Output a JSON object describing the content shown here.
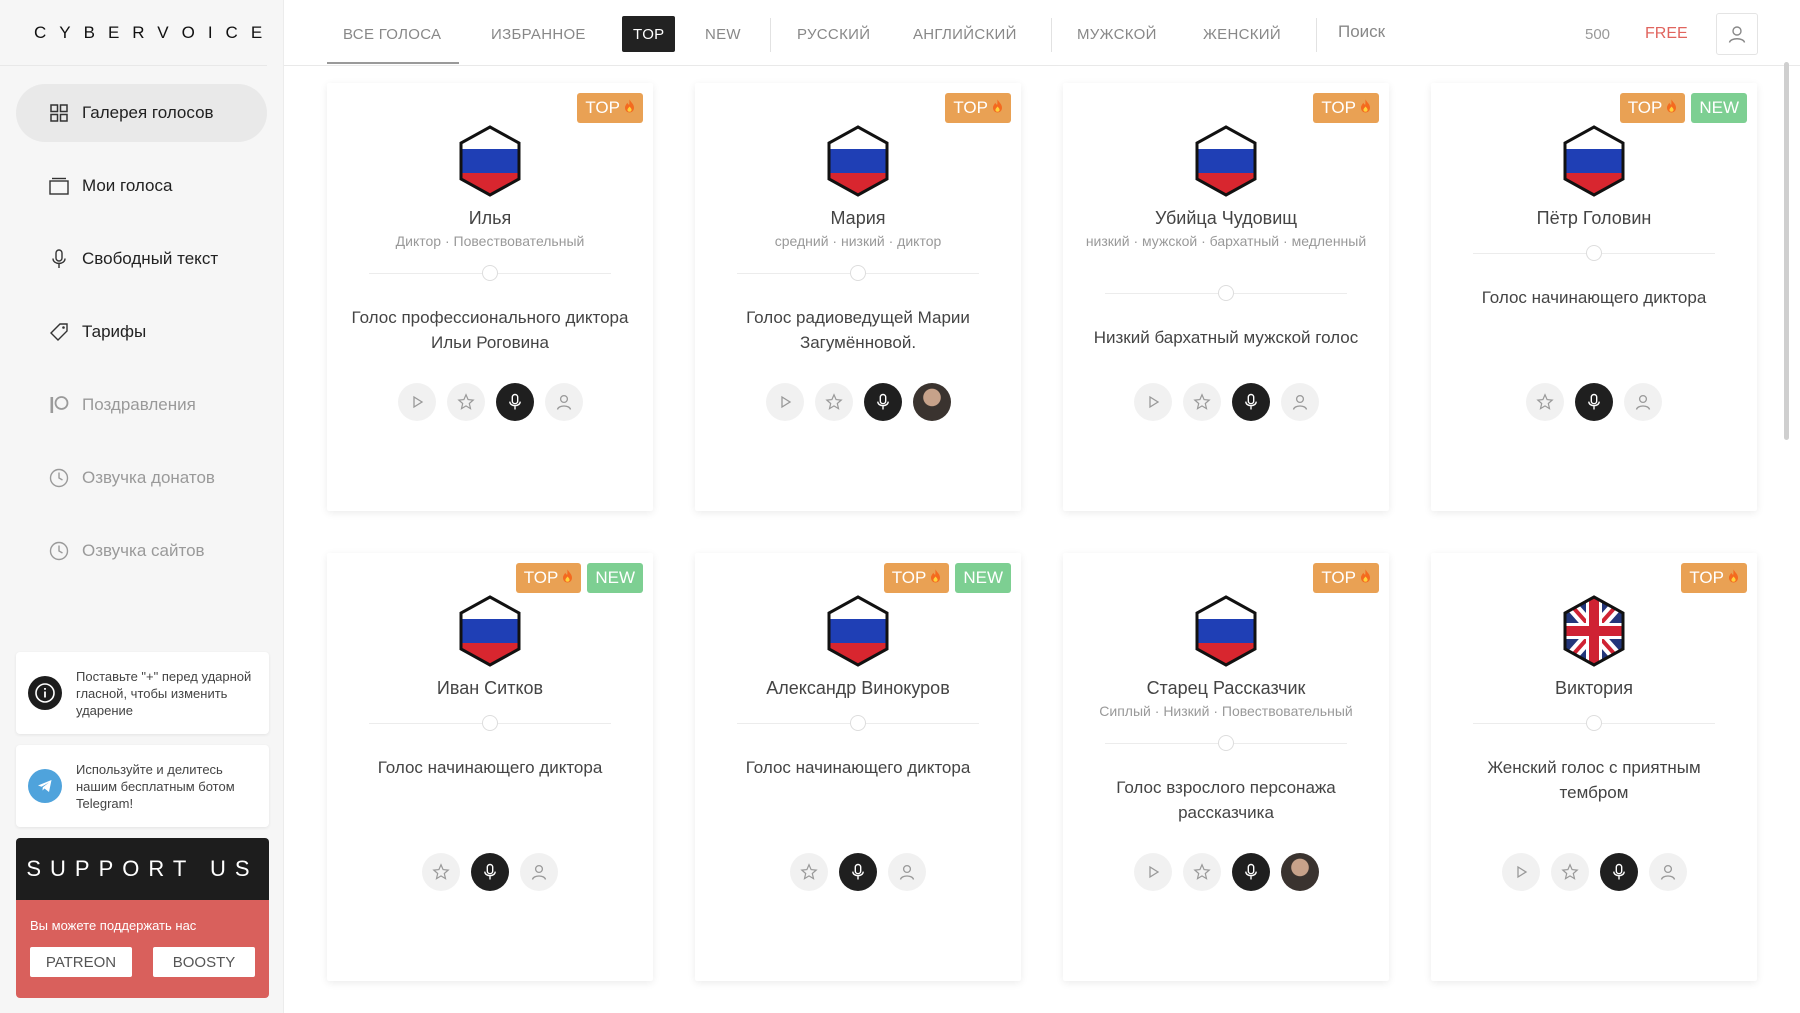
{
  "app": {
    "logo": "CYBERVOICE"
  },
  "sidebar": {
    "items": [
      {
        "label": "Галерея голосов",
        "icon": "grid-icon",
        "active": true,
        "muted": false
      },
      {
        "label": "Мои голоса",
        "icon": "folder-icon",
        "active": false,
        "muted": false
      },
      {
        "label": "Свободный текст",
        "icon": "microphone-icon",
        "active": false,
        "muted": false
      },
      {
        "label": "Тарифы",
        "icon": "tag-icon",
        "active": false,
        "muted": false
      },
      {
        "label": "Поздравления",
        "icon": "patreon-icon",
        "active": false,
        "muted": true
      },
      {
        "label": "Озвучка донатов",
        "icon": "clock-icon",
        "active": false,
        "muted": true
      },
      {
        "label": "Озвучка сайтов",
        "icon": "clock-icon",
        "active": false,
        "muted": true
      }
    ],
    "tips": [
      {
        "text": "Поставьте \"+\" перед ударной гласной, чтобы изменить ударение",
        "icon": "info-icon"
      },
      {
        "text": "Используйте и делитесь нашим бесплатным ботом Telegram!",
        "icon": "telegram-icon"
      }
    ],
    "support": {
      "title": "SUPPORT US",
      "subtitle": "Вы можете поддержать нас",
      "patreon": "PATREON",
      "boosty": "BOOSTY"
    }
  },
  "topbar": {
    "tabs": [
      {
        "label": "ВСЕ ГОЛОСА",
        "underlined": true
      },
      {
        "label": "ИЗБРАННОЕ"
      },
      {
        "label": "TOP",
        "selected": true
      },
      {
        "label": "NEW"
      },
      {
        "label": "РУССКИЙ"
      },
      {
        "label": "АНГЛИЙСКИЙ"
      },
      {
        "label": "МУЖСКОЙ"
      },
      {
        "label": "ЖЕНСКИЙ"
      }
    ],
    "search_label": "Поиск",
    "counter": "500",
    "plan": "FREE"
  },
  "cards": [
    {
      "name": "Илья",
      "tags": [
        "Диктор",
        "Повествовательный"
      ],
      "desc": "Голос профессионального диктора Ильи Роговина",
      "badges": [
        "TOP"
      ],
      "flag": "ru",
      "play": true,
      "avatar": false
    },
    {
      "name": "Мария",
      "tags": [
        "средний",
        "низкий",
        "диктор"
      ],
      "desc": "Голос радиоведущей Марии Загумённовой.",
      "badges": [
        "TOP"
      ],
      "flag": "ru",
      "play": true,
      "avatar": true
    },
    {
      "name": "Убийца Чудовищ",
      "tags": [
        "низкий",
        "мужской",
        "бархатный",
        "медленный"
      ],
      "desc": "Низкий бархатный мужской голос",
      "badges": [
        "TOP"
      ],
      "flag": "ru",
      "play": true,
      "avatar": false
    },
    {
      "name": "Пётр Головин",
      "tags": [],
      "desc": "Голос начинающего диктора",
      "badges": [
        "TOP",
        "NEW"
      ],
      "flag": "ru",
      "play": false,
      "avatar": false
    },
    {
      "name": "Иван Ситков",
      "tags": [],
      "desc": "Голос начинающего диктора",
      "badges": [
        "TOP",
        "NEW"
      ],
      "flag": "ru",
      "play": false,
      "avatar": false
    },
    {
      "name": "Александр Винокуров",
      "tags": [],
      "desc": "Голос начинающего диктора",
      "badges": [
        "TOP",
        "NEW"
      ],
      "flag": "ru",
      "play": false,
      "avatar": false
    },
    {
      "name": "Старец Рассказчик",
      "tags": [
        "Сиплый",
        "Низкий",
        "Повествовательный"
      ],
      "desc": "Голос взрослого персонажа рассказчика",
      "badges": [
        "TOP"
      ],
      "flag": "ru",
      "play": true,
      "avatar": true
    },
    {
      "name": "Виктория",
      "tags": [],
      "desc": "Женский голос с приятным тембром",
      "badges": [
        "TOP"
      ],
      "flag": "uk",
      "play": true,
      "avatar": false
    }
  ]
}
